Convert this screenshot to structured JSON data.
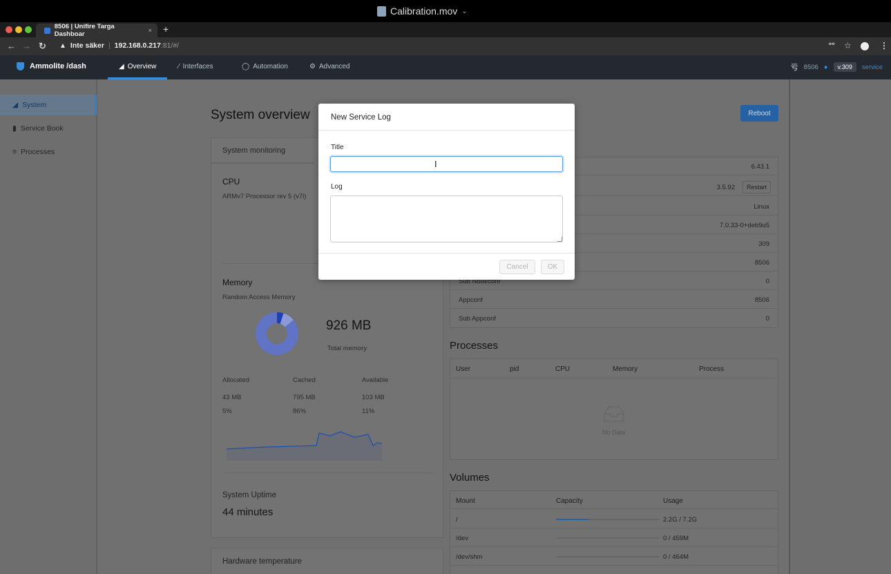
{
  "window": {
    "title": "Calibration.mov"
  },
  "browser": {
    "tab_title": "8506 | Unifire Targa Dashboar",
    "tab_close": "×",
    "new_tab": "+",
    "insecure_label": "Inte säker",
    "url_host": "192.168.0.217",
    "url_path": ":81/#/"
  },
  "app": {
    "brand": "Ammolite /dash",
    "nav": [
      "Overview",
      "Interfaces",
      "Automation",
      "Advanced"
    ],
    "right": {
      "node": "8506",
      "version": "v.309",
      "service": "service"
    }
  },
  "sidebar": {
    "items": [
      "System",
      "Service Book",
      "Processes"
    ]
  },
  "page": {
    "title": "System overview",
    "reboot_label": "Reboot"
  },
  "monitoring": {
    "tab": "System monitoring",
    "cpu_title": "CPU",
    "cpu_model": "ARMv7 Processor rev 5 (v7l)",
    "memory_title": "Memory",
    "memory_sub": "Random Access Memory",
    "memory_total": "926 MB",
    "memory_total_label": "Total memory",
    "mem_headers": [
      "Allocated",
      "Cached",
      "Available"
    ],
    "mem_values": [
      "43 MB",
      "795 MB",
      "103 MB"
    ],
    "mem_percents": [
      "5%",
      "86%",
      "11%"
    ],
    "mem_fraction_allocated": 0.05,
    "mem_fraction_cached": 0.86,
    "uptime_title": "System Uptime",
    "uptime_value": "44 minutes",
    "hw_temp_title": "Hardware temperature"
  },
  "info_table": {
    "rows": [
      {
        "label": "",
        "value": "6.43.1"
      },
      {
        "label": "",
        "value": "3.5.92"
      },
      {
        "label": "",
        "value": "Linux"
      },
      {
        "label": "",
        "value": "7.0.33-0+deb9u5"
      },
      {
        "label": "",
        "value": "309"
      },
      {
        "label": "",
        "value": "8506"
      },
      {
        "label": "Sub Nodeconf",
        "value": "0"
      },
      {
        "label": "Appconf",
        "value": "8506"
      },
      {
        "label": "Sub Appconf",
        "value": "0"
      }
    ],
    "restart_label": "Restart"
  },
  "processes": {
    "title": "Processes",
    "headers": [
      "User",
      "pid",
      "CPU",
      "Memory",
      "Process"
    ],
    "empty": "No Data"
  },
  "volumes": {
    "title": "Volumes",
    "headers": [
      "Mount",
      "Capacity",
      "Usage"
    ],
    "rows": [
      {
        "mount": "/",
        "used": "2.2G",
        "total": "7.2G",
        "fraction": 0.31
      },
      {
        "mount": "/dev",
        "used": "0",
        "total": "459M",
        "fraction": 0
      },
      {
        "mount": "/dev/shm",
        "used": "0",
        "total": "464M",
        "fraction": 0
      }
    ]
  },
  "modal": {
    "title": "New Service Log",
    "title_field_label": "Title",
    "log_field_label": "Log",
    "title_value": "",
    "log_value": "",
    "cancel_label": "Cancel",
    "ok_label": "OK"
  },
  "colors": {
    "accent": "#3b8cd8",
    "navbar": "#23292f"
  }
}
